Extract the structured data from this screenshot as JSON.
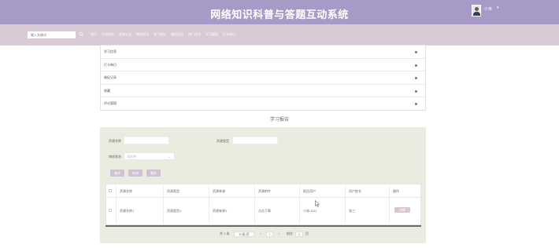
{
  "header": {
    "title": "网络知识科普与答题互动系统",
    "user_name": "小米",
    "user_caret": "▾"
  },
  "nav": {
    "search_placeholder": "输入关键词",
    "items": [
      "首页",
      "在线测试",
      "系统公告",
      "网络资讯",
      "学习报告",
      "随机论坛",
      "热门活动",
      "学习题组",
      "打卡每日"
    ]
  },
  "dropdown": {
    "items": [
      "学习信息",
      "打卡每日",
      "催促记录",
      "收藏",
      "评论管理"
    ]
  },
  "section_title": "学习报告",
  "search_form": {
    "name_label": "资源名称",
    "type_label": "资源类型",
    "status_label": "审核状态",
    "status_placeholder": "请选择"
  },
  "buttons": {
    "query": "查询",
    "add": "新增",
    "delete": "删除"
  },
  "table": {
    "headers": [
      "",
      "资源名称",
      "资源类型",
      "资源来源",
      "资源附件",
      "报告用户",
      "用户姓名",
      "操作"
    ],
    "rows": [
      {
        "name": "资源名称1",
        "type": "资源类型1",
        "source": "资源来源1",
        "attachment": "点击下载",
        "report_user": "小张-1111",
        "user_name": "张三",
        "op": "详情"
      }
    ]
  },
  "pagination": {
    "total": "共 1 条",
    "page_size": "10条/页",
    "prev": "‹",
    "page": "1",
    "next": "›",
    "goto_label": "前往",
    "goto_value": "1",
    "page_unit": "页"
  }
}
